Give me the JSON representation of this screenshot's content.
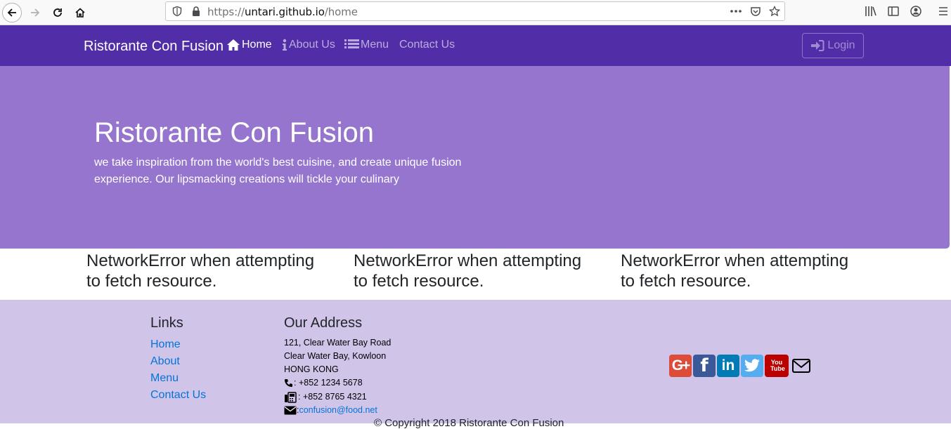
{
  "browser": {
    "url_prefix": "https://",
    "url_host": "untari.github.io",
    "url_path": "/home"
  },
  "navbar": {
    "brand": "Ristorante Con Fusion",
    "items": [
      {
        "label": "Home",
        "icon": "home-icon"
      },
      {
        "label": "About Us",
        "icon": "info-icon"
      },
      {
        "label": "Menu",
        "icon": "list-icon"
      },
      {
        "label": "Contact Us",
        "icon": ""
      }
    ],
    "login_label": "Login",
    "color": "#512da8"
  },
  "jumbotron": {
    "title": "Ristorante Con Fusion",
    "text": "we take inspiration from the world's best cuisine, and create unique fusion experience. Our lipsmacking creations will tickle your culinary",
    "color": "#9575cd"
  },
  "errors": [
    "NetworkError when attempting to fetch resource.",
    "NetworkError when attempting to fetch resource.",
    "NetworkError when attempting to fetch resource."
  ],
  "footer": {
    "links_heading": "Links",
    "links": [
      "Home",
      "About",
      "Menu",
      "Contact Us"
    ],
    "address_heading": "Our Address",
    "address_lines": [
      "121, Clear Water Bay Road",
      "Clear Water Bay, Kowloon",
      "HONG KONG"
    ],
    "phone": ": +852 1234 5678",
    "fax": ": +852 8765 4321",
    "email_prefix": ": ",
    "email": "confusion@food.net",
    "copyright": "© Copyright 2018 Ristorante Con Fusion",
    "social": [
      {
        "name": "google-plus-icon",
        "glyph": "G+",
        "color": "#dd4b39"
      },
      {
        "name": "facebook-icon",
        "glyph": "f",
        "color": "#3b5998"
      },
      {
        "name": "linkedin-icon",
        "glyph": "in",
        "color": "#007bb6"
      },
      {
        "name": "twitter-icon",
        "glyph": "t",
        "color": "#55acee"
      },
      {
        "name": "youtube-icon",
        "glyph": "You Tube",
        "color": "#bb0000"
      },
      {
        "name": "envelope-icon",
        "glyph": "",
        "color": "#000000"
      }
    ],
    "color": "#d1c4e9"
  }
}
